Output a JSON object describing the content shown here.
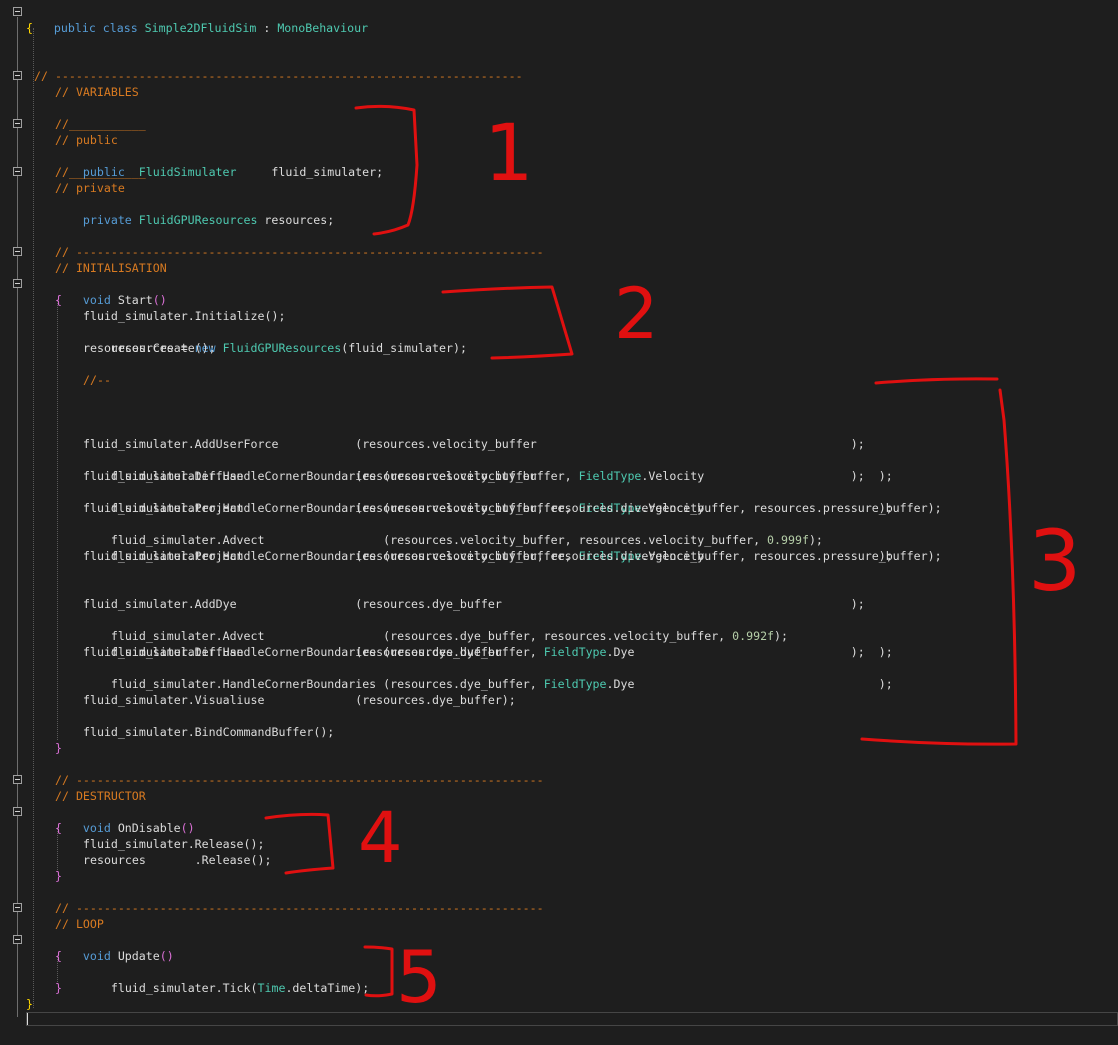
{
  "lines": [
    "public class Simple2DFluidSim : MonoBehaviour",
    "{",
    "// -------------------------------------------------------------------",
    "// VARIABLES",
    "//___________",
    "// public",
    "public  FluidSimulater     fluid_simulater;",
    "//___________",
    "// private",
    "private FluidGPUResources resources;",
    "// -------------------------------------------------------------------",
    "// INITALISATION",
    "void Start()",
    "{",
    "fluid_simulater.Initialize();",
    "resources = new FluidGPUResources(fluid_simulater);",
    "resources.Create();",
    "//--",
    "fluid_simulater.AddUserForce           (resources.velocity_buffer                                             );",
    "fluid_simulater.HandleCornerBoundaries (resources.velocity_buffer, FieldType.Velocity                         );",
    "fluid_simulater.Diffuse                (resources.velocity_buffer                                             );",
    "fluid_simulater.HandleCornerBoundaries (resources.velocity_buffer, FieldType.Velocity                         );",
    "fluid_simulater.Project                (resources.velocity_buffer, resources.divergence_buffer, resources.pressure_buffer);",
    "fluid_simulater.Advect                 (resources.velocity_buffer, resources.velocity_buffer, 0.999f);",
    "fluid_simulater.HandleCornerBoundaries (resources.velocity_buffer, FieldType.Velocity                         );",
    "fluid_simulater.Project                (resources.velocity_buffer, resources.divergence_buffer, resources.pressure_buffer);",
    "fluid_simulater.AddDye                 (resources.dye_buffer                                                  );",
    "fluid_simulater.Advect                 (resources.dye_buffer, resources.velocity_buffer, 0.992f);",
    "fluid_simulater.HandleCornerBoundaries (resources.dye_buffer, FieldType.Dye                                   );",
    "fluid_simulater.Diffuse                (resources.dye_buffer                                                  );",
    "fluid_simulater.HandleCornerBoundaries (resources.dye_buffer, FieldType.Dye                                   );",
    "fluid_simulater.Visualiuse             (resources.dye_buffer);",
    "fluid_simulater.BindCommandBuffer();",
    "}",
    "// -------------------------------------------------------------------",
    "// DESTRUCTOR",
    "void OnDisable()",
    "{",
    "fluid_simulater.Release();",
    "resources       .Release();",
    "}",
    "// -------------------------------------------------------------------",
    "// LOOP",
    "void Update()",
    "{",
    "fluid_simulater.Tick(Time.deltaTime);",
    "}",
    "}"
  ],
  "annotations": {
    "color": "#e01010",
    "labels": [
      "1",
      "2",
      "3",
      "4",
      "5"
    ]
  },
  "colors": {
    "background": "#1e1e1e",
    "keyword": "#569cd6",
    "type": "#4ec9b0",
    "comment": "#d87a21",
    "text": "#dcdcdc",
    "brace": "#ffd700",
    "paren": "#da70d6",
    "number": "#b5cea8"
  }
}
